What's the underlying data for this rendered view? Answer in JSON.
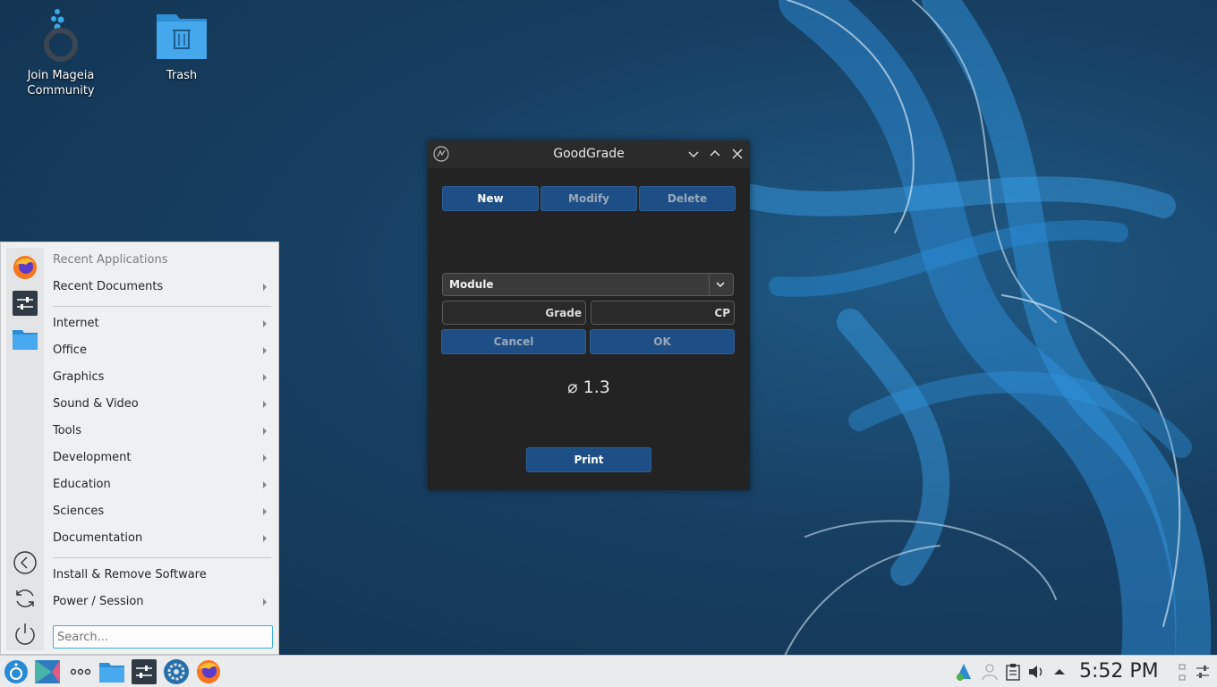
{
  "desktop": {
    "icons": [
      {
        "label_line1": "Join Mageia",
        "label_line2": "Community",
        "icon": "mageia-icon"
      },
      {
        "label": "Trash",
        "icon": "trash-icon"
      }
    ]
  },
  "window": {
    "title": "GoodGrade",
    "buttons": {
      "new": "New",
      "modify": "Modify",
      "delete": "Delete"
    },
    "combo_value": "Module",
    "grade_placeholder": "Grade",
    "cp_placeholder": "CP",
    "cancel": "Cancel",
    "ok": "OK",
    "average": "⌀ 1.3",
    "print": "Print"
  },
  "start_menu": {
    "header": "Recent Applications",
    "items": [
      {
        "label": "Recent Documents",
        "submenu": true
      },
      {
        "label": "Internet",
        "submenu": true
      },
      {
        "label": "Office",
        "submenu": true
      },
      {
        "label": "Graphics",
        "submenu": true
      },
      {
        "label": "Sound & Video",
        "submenu": true
      },
      {
        "label": "Tools",
        "submenu": true
      },
      {
        "label": "Development",
        "submenu": true
      },
      {
        "label": "Education",
        "submenu": true
      },
      {
        "label": "Sciences",
        "submenu": true
      },
      {
        "label": "Documentation",
        "submenu": true
      },
      {
        "label": "Install & Remove Software",
        "submenu": false
      },
      {
        "label": "Power / Session",
        "submenu": true
      }
    ],
    "search_placeholder": "Search..."
  },
  "taskbar": {
    "clock": "5:52 PM"
  },
  "colors": {
    "accent": "#1d4f86",
    "focus": "#3daee9"
  }
}
